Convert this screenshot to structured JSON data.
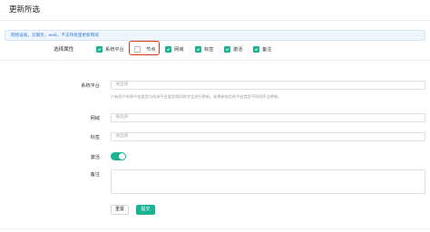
{
  "page": {
    "title": "更新所选"
  },
  "banner": {
    "text": "网络设备，云服务，web，不支持批量更新网域"
  },
  "attributes": {
    "label": "选择属性",
    "options": [
      {
        "label": "系统平台",
        "checked": true
      },
      {
        "label": "节点",
        "checked": false
      },
      {
        "label": "网域",
        "checked": true
      },
      {
        "label": "标签",
        "checked": true
      },
      {
        "label": "激活",
        "checked": true
      },
      {
        "label": "备注",
        "checked": true
      }
    ]
  },
  "form": {
    "platform": {
      "label": "系统平台",
      "placeholder": "请选择",
      "hint": "只有资产的原平台类型与所选平台类型相同时才会进行更新。若更新前后的平台类型不同则不会更新。"
    },
    "domain": {
      "label": "网域",
      "placeholder": "请选择"
    },
    "tags": {
      "label": "标签",
      "placeholder": "请选择"
    },
    "active": {
      "label": "激活",
      "value": true
    },
    "comment": {
      "label": "备注",
      "value": ""
    }
  },
  "buttons": {
    "reset": "重置",
    "submit": "提交"
  },
  "colors": {
    "accent": "#1ab394",
    "highlight": "#e0341c",
    "banner_text": "#3b7fd4"
  }
}
